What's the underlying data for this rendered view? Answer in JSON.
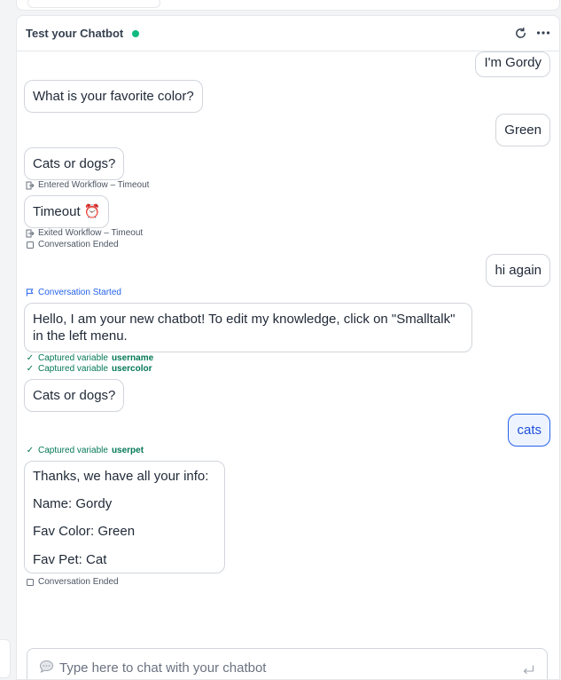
{
  "panel": {
    "title": "Test your Chatbot",
    "status_color": "#10b981",
    "accent_color": "#2563eb"
  },
  "messages": [
    {
      "role": "user",
      "text": "I'm Gordy"
    },
    {
      "role": "bot",
      "text": "What is your favorite color?"
    },
    {
      "role": "user",
      "text": "Green"
    },
    {
      "role": "bot",
      "text": "Cats or dogs?"
    },
    {
      "role": "event",
      "icon": "enter-icon",
      "text": "Entered Workflow – Timeout"
    },
    {
      "role": "bot",
      "text": "Timeout ⏰"
    },
    {
      "role": "event",
      "icon": "exit-icon",
      "text": "Exited Workflow – Timeout"
    },
    {
      "role": "event",
      "icon": "square-icon",
      "text": "Conversation Ended"
    },
    {
      "role": "user",
      "text": "hi again"
    },
    {
      "role": "event",
      "icon": "flag-icon",
      "text": "Conversation Started"
    },
    {
      "role": "bot",
      "text": "Hello, I am your new chatbot! To edit my knowledge, click on \"Smalltalk\" in the left menu."
    },
    {
      "role": "event",
      "icon": "check-icon",
      "text": "Captured variable",
      "var": "username"
    },
    {
      "role": "event",
      "icon": "check-icon",
      "text": "Captured variable",
      "var": "usercolor"
    },
    {
      "role": "bot",
      "text": "Cats or dogs?"
    },
    {
      "role": "user",
      "text": "cats"
    },
    {
      "role": "event",
      "icon": "check-icon",
      "text": "Captured variable",
      "var": "userpet"
    },
    {
      "role": "bot",
      "lines": [
        "Thanks, we have all your info:",
        "Name: Gordy",
        "Fav Color: Green",
        "Fav Pet: Cat"
      ]
    },
    {
      "role": "event",
      "icon": "square-icon",
      "text": "Conversation Ended"
    }
  ],
  "composer": {
    "placeholder": "Type here to chat with your chatbot",
    "icon": "speech-bubble-icon"
  }
}
